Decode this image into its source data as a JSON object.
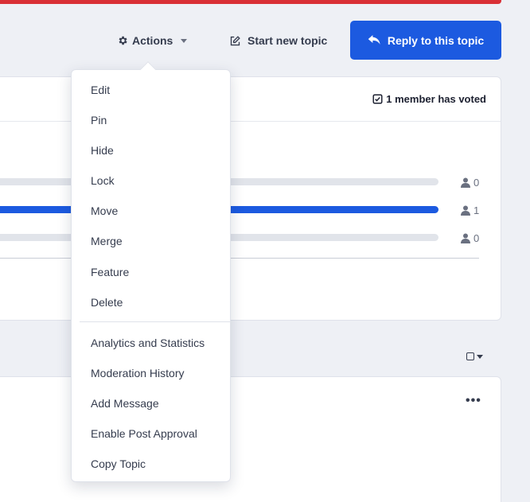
{
  "toolbar": {
    "actions_label": "Actions",
    "new_topic_label": "Start new topic",
    "reply_label": "Reply to this topic",
    "accent_color": "#1c5ae0",
    "alert_color": "#d93036"
  },
  "actions_menu": {
    "moderation_items": [
      {
        "label": "Edit"
      },
      {
        "label": "Pin"
      },
      {
        "label": "Hide"
      },
      {
        "label": "Lock"
      },
      {
        "label": "Move"
      },
      {
        "label": "Merge"
      },
      {
        "label": "Feature"
      },
      {
        "label": "Delete"
      }
    ],
    "tool_items": [
      {
        "label": "Analytics and Statistics"
      },
      {
        "label": "Moderation History"
      },
      {
        "label": "Add Message"
      },
      {
        "label": "Enable Post Approval"
      },
      {
        "label": "Copy Topic"
      }
    ]
  },
  "poll": {
    "voted_text": "1 member has voted",
    "choices": [
      {
        "votes": "0",
        "fill": 0
      },
      {
        "votes": "1",
        "fill": 1
      },
      {
        "votes": "0",
        "fill": 0
      }
    ]
  },
  "icons": {
    "actions": "gear-icon",
    "new_topic": "edit-icon",
    "reply": "reply-icon",
    "voted": "checked-box-icon",
    "voter": "user-icon",
    "more": "ellipsis-icon"
  }
}
